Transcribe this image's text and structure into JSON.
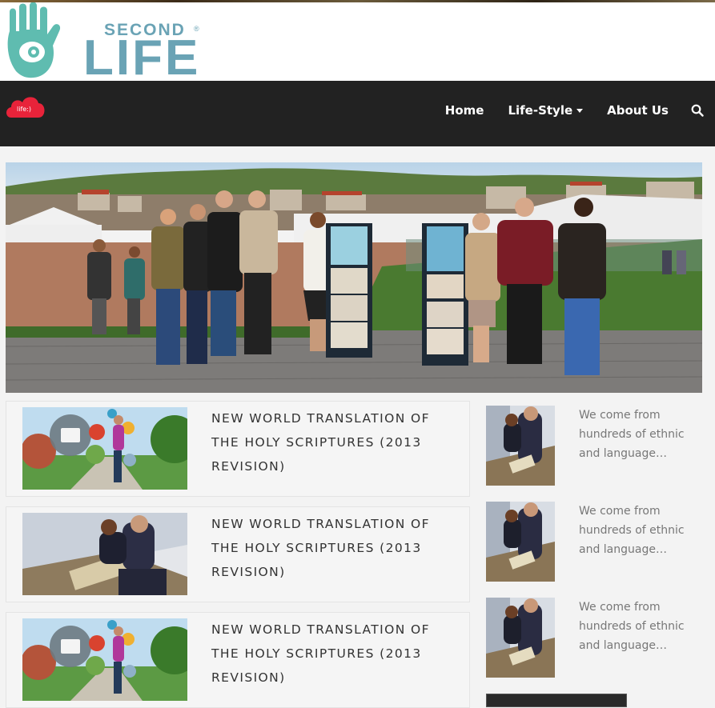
{
  "brand": {
    "logo_text_top": "SECOND",
    "logo_text_main": "LIFE",
    "registered": "®",
    "nav_logo_text": "life:)"
  },
  "nav": {
    "items": [
      {
        "label": "Home"
      },
      {
        "label": "Life-Style"
      },
      {
        "label": "About Us"
      }
    ],
    "search_icon": "search-icon"
  },
  "posts": [
    {
      "title": "NEW WORLD TRANSLATION OF THE HOLY SCRIPTURES (2013 REVISION)",
      "image": "app-icons-jogger"
    },
    {
      "title": "NEW WORLD TRANSLATION OF THE HOLY SCRIPTURES (2013 REVISION)",
      "image": "couple-at-display"
    },
    {
      "title": "NEW WORLD TRANSLATION OF THE HOLY SCRIPTURES (2013 REVISION)",
      "image": "app-icons-jogger"
    }
  ],
  "sidebar": {
    "items": [
      {
        "excerpt": "We come from hundreds of ethnic and language…"
      },
      {
        "excerpt": "We come from hundreds of ethnic and language…"
      },
      {
        "excerpt": "We come from hundreds of ethnic and language…"
      }
    ]
  },
  "colors": {
    "nav_bg": "#222222",
    "brand_teal": "#5fbcb0",
    "brand_blue": "#6aa3b5",
    "nav_logo_red": "#e8233a",
    "page_bg": "#f3f3f3"
  }
}
